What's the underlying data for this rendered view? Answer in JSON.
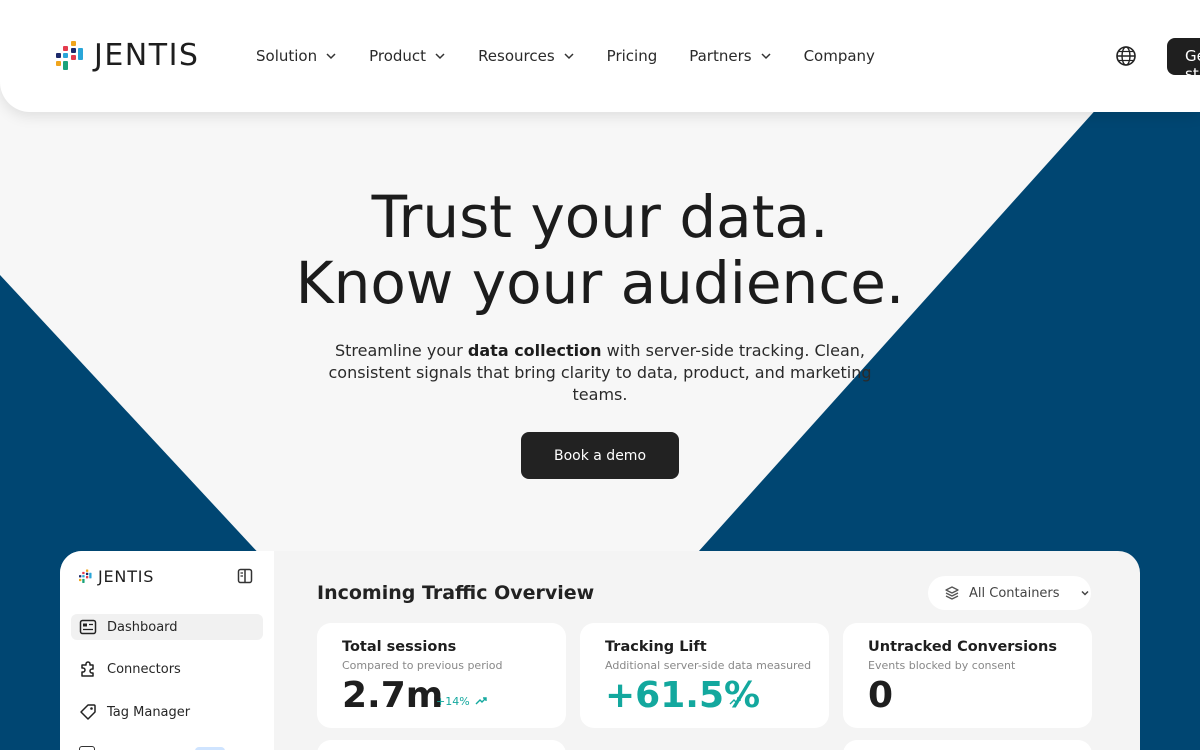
{
  "brand": {
    "name": "JENTIS"
  },
  "nav": {
    "items": [
      {
        "label": "Solution",
        "dropdown": true
      },
      {
        "label": "Product",
        "dropdown": true
      },
      {
        "label": "Resources",
        "dropdown": true
      },
      {
        "label": "Pricing",
        "dropdown": false
      },
      {
        "label": "Partners",
        "dropdown": true
      },
      {
        "label": "Company",
        "dropdown": false
      }
    ],
    "cta_label": "Get started"
  },
  "hero": {
    "title_line1": "Trust your data.",
    "title_line2": "Know your audience.",
    "sub_prefix": "Streamline your ",
    "sub_bold": "data collection",
    "sub_suffix": " with server-side tracking. Clean, consistent signals that bring clarity to data, product, and marketing teams.",
    "cta_label": "Book a demo"
  },
  "dashboard": {
    "brand": "JENTIS",
    "sidebar": [
      {
        "label": "Dashboard",
        "icon": "dashboard-icon",
        "active": true
      },
      {
        "label": "Connectors",
        "icon": "puzzle-icon",
        "active": false
      },
      {
        "label": "Tag Manager",
        "icon": "tag-icon",
        "active": false
      }
    ],
    "title": "Incoming Traffic Overview",
    "filter_label": "All Containers",
    "cards": [
      {
        "title": "Total sessions",
        "subtitle": "Compared to previous period",
        "value": "2.7m",
        "trend": "+14%"
      },
      {
        "title": "Tracking Lift",
        "subtitle": "Additional server-side data measured",
        "value": "+61.5%",
        "trend": ""
      },
      {
        "title": "Untracked Conversions",
        "subtitle": "Events blocked by consent",
        "value": "0",
        "trend": ""
      }
    ]
  },
  "colors": {
    "navy": "#004672",
    "dark_button": "#222222",
    "teal_accent": "#13a89e",
    "page_bg": "#f7f7f7"
  }
}
